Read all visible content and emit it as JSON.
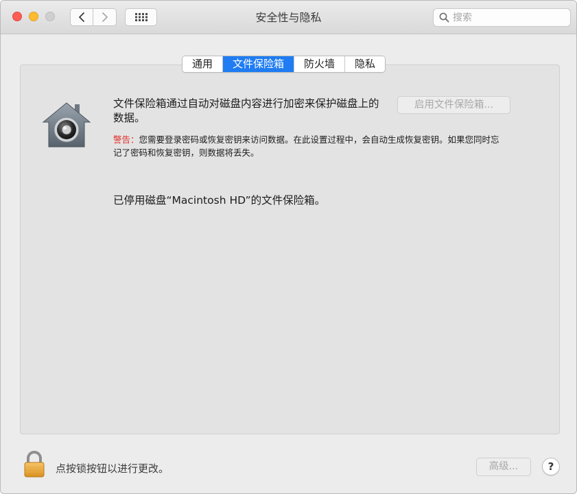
{
  "window": {
    "title": "安全性与隐私"
  },
  "search": {
    "placeholder": "搜索"
  },
  "tabs": [
    {
      "label": "通用",
      "active": false
    },
    {
      "label": "文件保险箱",
      "active": true
    },
    {
      "label": "防火墙",
      "active": false
    },
    {
      "label": "隐私",
      "active": false
    }
  ],
  "filevault": {
    "description": "文件保险箱通过自动对磁盘内容进行加密来保护磁盘上的数据。",
    "warning_label": "警告：",
    "warning_text": "您需要登录密码或恢复密钥来访问数据。在此设置过程中，会自动生成恢复密钥。如果您同时忘记了密码和恢复密钥，则数据将丢失。",
    "enable_button": "启用文件保险箱...",
    "status": "已停用磁盘“Macintosh HD”的文件保险箱。"
  },
  "footer": {
    "lock_text": "点按锁按钮以进行更改。",
    "advanced_button": "高级...",
    "help_button": "?"
  },
  "icons": {
    "close": "close-button-icon",
    "minimize": "minimize-button-icon",
    "zoom": "zoom-button-icon",
    "back": "chevron-left-icon",
    "forward": "chevron-right-icon",
    "grid": "grid-icon",
    "search": "search-icon",
    "vault": "filevault-house-icon",
    "lock": "lock-icon"
  },
  "colors": {
    "accent": "#1f7cf2",
    "warning": "#e0302a",
    "close": "#fd5f57",
    "minimize": "#febc2e"
  }
}
